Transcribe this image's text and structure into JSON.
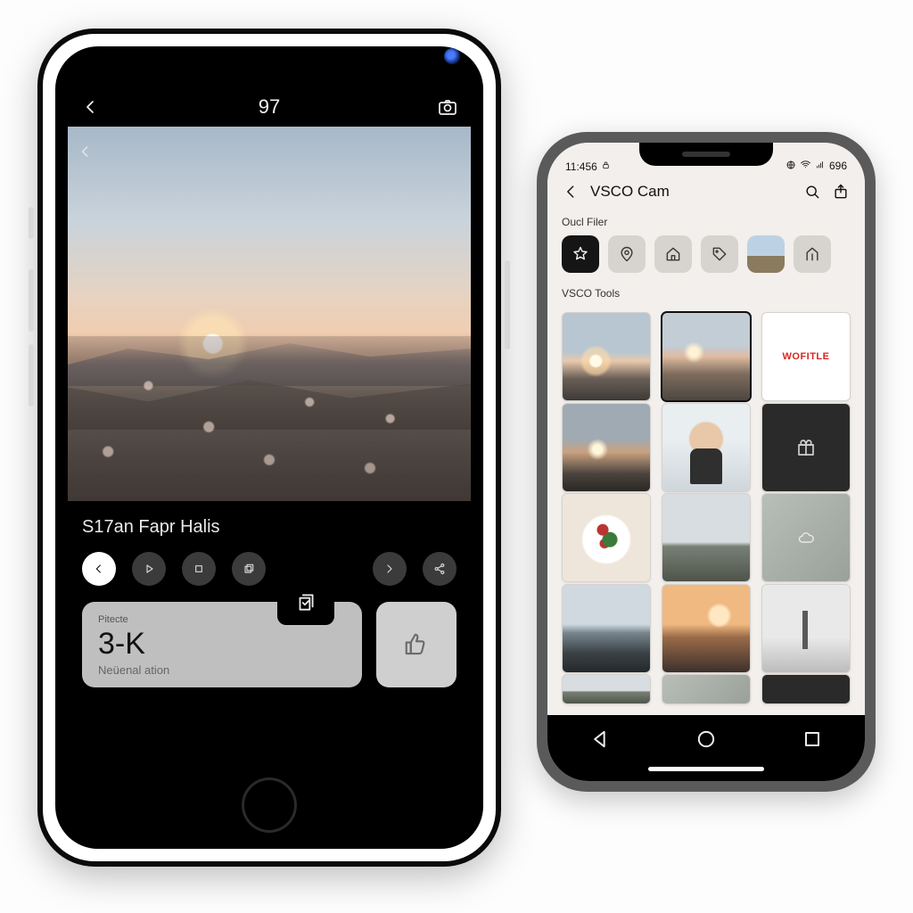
{
  "left": {
    "status_number": "97",
    "photo_title": "S17an Fapr Halis",
    "card": {
      "mini": "Pitecte",
      "headline": "3-K",
      "sub": "Neüenal ation"
    }
  },
  "right": {
    "status": {
      "time": "11:456",
      "battery": "696"
    },
    "app_title": "VSCO Cam",
    "filters_heading": "Oucl Filer",
    "tools_heading": "VSCO Tools",
    "brand_tile": "WOFITLE"
  }
}
